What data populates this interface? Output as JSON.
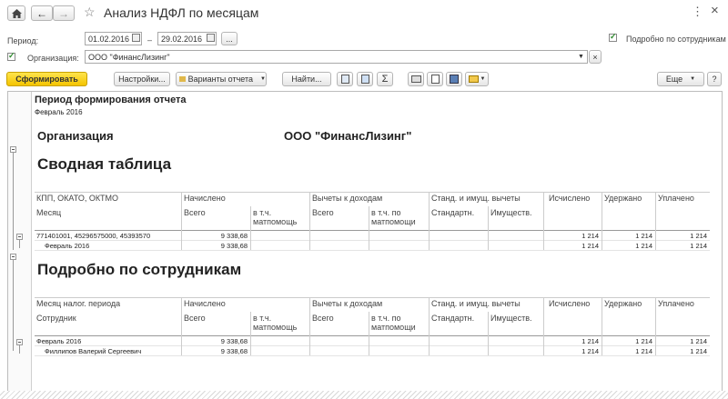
{
  "window": {
    "title": "Анализ НДФЛ по месяцам"
  },
  "params": {
    "period_label": "Период:",
    "date_from": "01.02.2016",
    "date_sep": "–",
    "date_to": "29.02.2016",
    "ellipsis": "...",
    "detail_label": "Подробно по сотрудникам",
    "org_label": "Организация:",
    "org_value": "ООО \"ФинансЛизинг\""
  },
  "toolbar": {
    "generate": "Сформировать",
    "settings": "Настройки...",
    "variants": "Варианты отчета",
    "find": "Найти...",
    "sigma": "Σ",
    "more": "Еще",
    "help": "?"
  },
  "report": {
    "period_title": "Период формирования отчета",
    "period_value": "Февраль 2016",
    "org_caption": "Организация",
    "org_name": "ООО \"ФинансЛизинг\"",
    "summary_title": "Сводная таблица",
    "detail_title": "Подробно по сотрудникам",
    "t1": {
      "h1": [
        "КПП, ОКАТО, ОКТМО",
        "Начислено",
        "Вычеты к доходам",
        "Станд. и имущ. вычеты",
        "Исчислено",
        "Удержано",
        "Уплачено"
      ],
      "h2": [
        "Месяц",
        "Всего",
        "в т.ч. матпомощь",
        "Всего",
        "в т.ч. по матпомощи",
        "Стандартн.",
        "Имуществ."
      ],
      "rows": [
        {
          "label": "771401001, 45296575000, 45393570",
          "total": "9 338,68",
          "calc": "1 214",
          "held": "1 214",
          "paid": "1 214"
        },
        {
          "label": "Февраль 2016",
          "total": "9 338,68",
          "calc": "1 214",
          "held": "1 214",
          "paid": "1 214"
        }
      ]
    },
    "t2": {
      "h1": [
        "Месяц налог. периода",
        "Начислено",
        "Вычеты к доходам",
        "Станд. и имущ. вычеты",
        "Исчислено",
        "Удержано",
        "Уплачено"
      ],
      "h2": [
        "Сотрудник",
        "Всего",
        "в т.ч. матпомощь",
        "Всего",
        "в т.ч. по матпомощи",
        "Стандартн.",
        "Имуществ."
      ],
      "rows": [
        {
          "label": "Февраль 2016",
          "total": "9 338,68",
          "calc": "1 214",
          "held": "1 214",
          "paid": "1 214"
        },
        {
          "label": "Филлипов Валерий Сергеевич",
          "total": "9 338,68",
          "calc": "1 214",
          "held": "1 214",
          "paid": "1 214"
        }
      ]
    }
  }
}
